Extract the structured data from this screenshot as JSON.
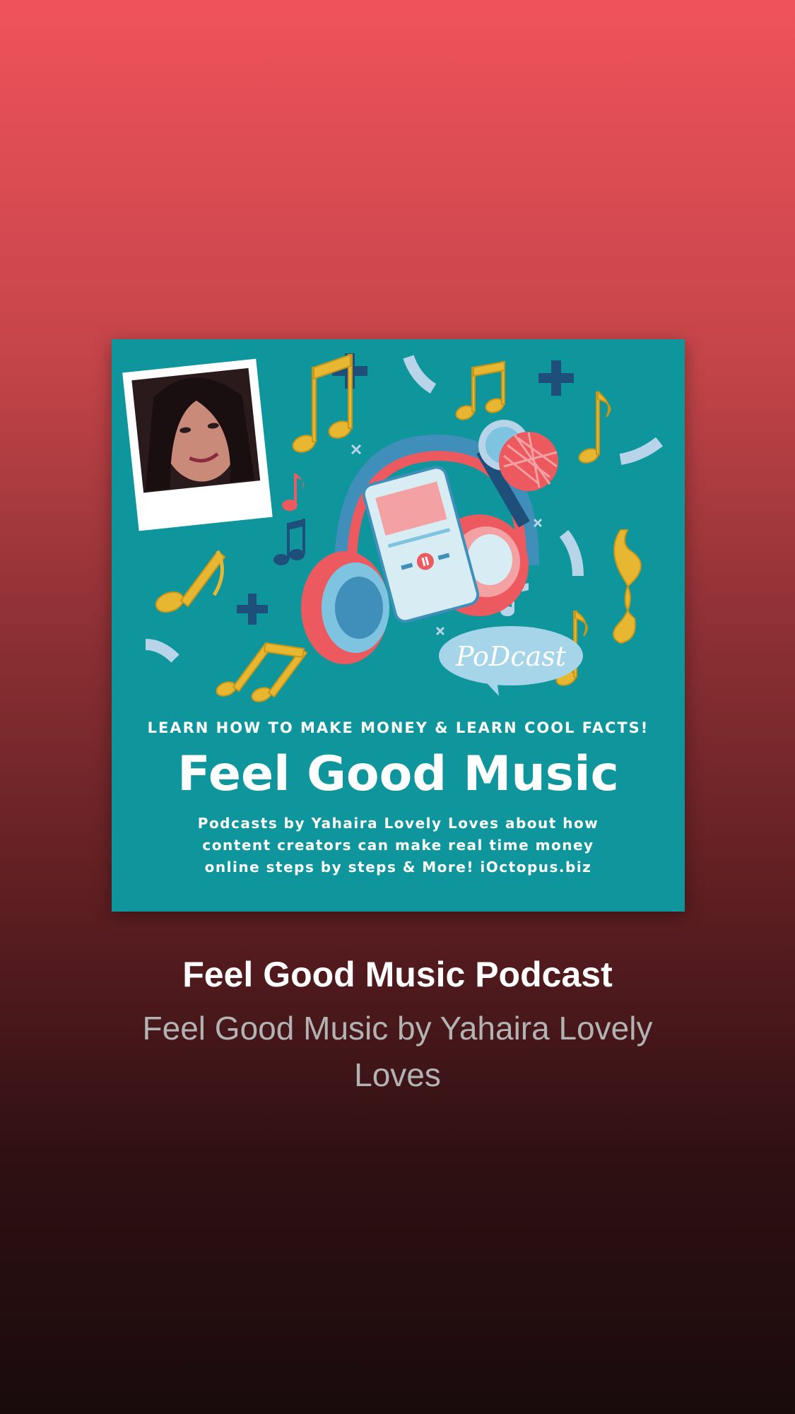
{
  "cover": {
    "tagline": "LEARN HOW TO MAKE MONEY & LEARN COOL FACTS!",
    "title": "Feel Good Music",
    "description": "Podcasts by Yahaira Lovely Loves about how content creators can make real time money online steps by steps & More! iOctopus.biz",
    "bubble_text": "PoDcast",
    "background_color": "#0f959c"
  },
  "episode": {
    "title": "Feel Good Music Podcast",
    "show_name": "Feel Good Music by Yahaira Lovely Loves"
  },
  "colors": {
    "gradient_top": "#f0525b",
    "gradient_bottom": "#190b0c",
    "title_color": "#ffffff",
    "subtitle_color": "#b3b3b3"
  }
}
